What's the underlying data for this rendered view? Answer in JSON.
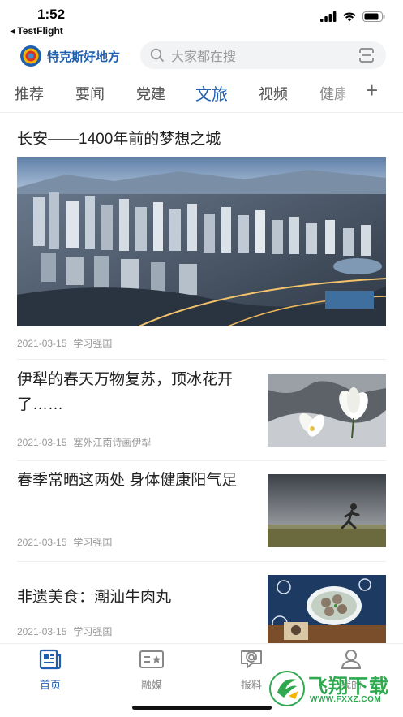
{
  "status_bar": {
    "time": "1:52",
    "back_app": "◂ TestFlight"
  },
  "header": {
    "logo_name": "特克斯好地方",
    "search_placeholder": "大家都在搜"
  },
  "tabs": [
    {
      "label": "推荐",
      "active": false
    },
    {
      "label": "要闻",
      "active": false
    },
    {
      "label": "党建",
      "active": false
    },
    {
      "label": "文旅",
      "active": true
    },
    {
      "label": "视频",
      "active": false
    },
    {
      "label": "健康",
      "active": false
    }
  ],
  "tab_add_label": "+",
  "feature": {
    "title": "长安——1400年前的梦想之城",
    "date": "2021-03-15",
    "source": "学习强国"
  },
  "articles": [
    {
      "title": "伊犁的春天万物复苏，顶冰花开了……",
      "date": "2021-03-15",
      "source": "塞外江南诗画伊犁"
    },
    {
      "title": "春季常晒这两处 身体健康阳气足",
      "date": "2021-03-15",
      "source": "学习强国"
    },
    {
      "title": "非遗美食：潮汕牛肉丸",
      "date": "2021-03-15",
      "source": "学习强国"
    }
  ],
  "bottom_nav": [
    {
      "label": "首页",
      "icon": "news-icon",
      "active": true
    },
    {
      "label": "融媒",
      "icon": "media-icon",
      "active": false
    },
    {
      "label": "报料",
      "icon": "report-icon",
      "active": false
    },
    {
      "label": "我的",
      "icon": "user-icon",
      "active": false
    }
  ],
  "watermark": {
    "text": "飞翔下载",
    "url": "WWW.FXXZ.COM"
  },
  "colors": {
    "accent": "#1f5fb0",
    "muted": "#999999",
    "watermark": "#2fa84f"
  }
}
